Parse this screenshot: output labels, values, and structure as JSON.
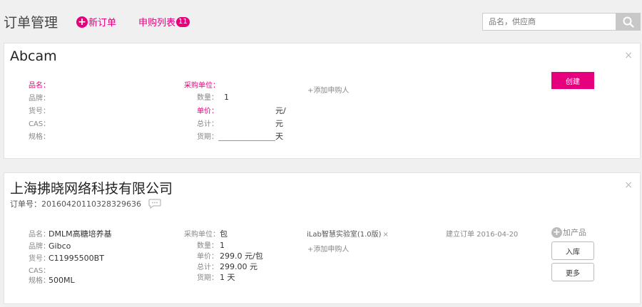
{
  "header": {
    "title": "订单管理",
    "new_order_label": "新订单",
    "purchase_list_label": "申购列表",
    "purchase_list_count": "11",
    "search_placeholder": "品名，供应商"
  },
  "card1": {
    "supplier": "Abcam",
    "fields": {
      "name_label": "品名：",
      "brand_label": "品牌：",
      "item_no_label": "货号：",
      "cas_label": "CAS：",
      "spec_label": "规格：",
      "buyer_unit_label": "采购单位：",
      "quantity_label": "数量：",
      "quantity_value": "1",
      "unit_price_label": "单价：",
      "unit_price_suffix": "元/",
      "total_label": "总计：",
      "total_suffix": "元",
      "delivery_label": "货期：",
      "delivery_suffix": "天"
    },
    "add_buyer": "+添加申购人",
    "create_button": "创建"
  },
  "card2": {
    "supplier": "上海拂晓网络科技有限公司",
    "order_number": "订单号：20160420110328329636",
    "fields": {
      "name_label": "品名：",
      "name_value": "DMLM高糖培养基",
      "brand_label": "品牌：",
      "brand_value": "Gibco",
      "item_no_label": "货号：",
      "item_no_value": "C11995500BT",
      "cas_label": "CAS：",
      "spec_label": "规格：",
      "spec_value": "500ML",
      "buyer_unit_label": "采购单位：",
      "buyer_unit_value": "包",
      "quantity_label": "数量：",
      "quantity_value": "1",
      "unit_price_label": "单价：",
      "unit_price_value": "299.0  元/包",
      "total_label": "总计：",
      "total_value": "299.00 元",
      "delivery_label": "货期：",
      "delivery_value": "1  天"
    },
    "lab": "iLab智慧实验室(1.0版)",
    "lab_remove": "×",
    "add_buyer": "+添加申购人",
    "created_date": "建立订单  2016-04-20",
    "add_product": "加产品",
    "stock_in_button": "入库",
    "more_button": "更多"
  },
  "close_symbol": "×",
  "colors": {
    "accent": "#e6007e",
    "background": "#f0f0f0",
    "card": "#ffffff"
  }
}
